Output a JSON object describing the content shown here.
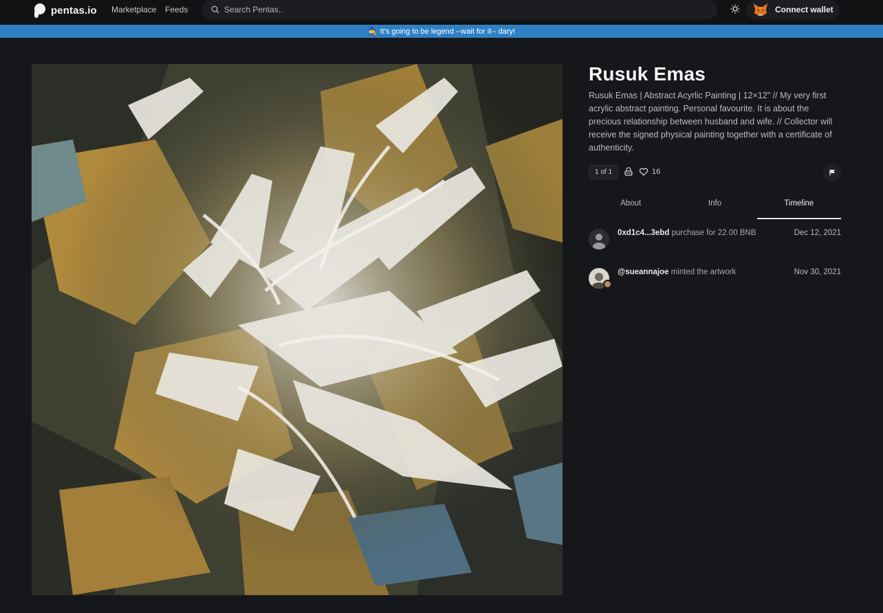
{
  "nav": {
    "logo_text": "pentas.io",
    "links": [
      "Marketplace",
      "Feeds"
    ],
    "search_placeholder": "Search Pentas..",
    "connect_label": "Connect wallet"
  },
  "banner": {
    "icon": "🧙",
    "text": "It's going to be legend --wait for it-- dary!"
  },
  "artwork": {
    "title": "Rusuk Emas",
    "description": "Rusuk Emas | Abstract Acyrlic Painting | 12×12\" // My very first acrylic abstract painting. Personal favourite. It is about the precious relationship between husband and wife. // Collector will receive the signed physical painting together with a certificate of authenticity.",
    "edition": "1 of 1",
    "likes": "16"
  },
  "tabs": [
    {
      "label": "About"
    },
    {
      "label": "Info"
    },
    {
      "label": "Timeline"
    }
  ],
  "timeline": [
    {
      "actor": "0xd1c4...3ebd",
      "action": "purchase for 22.00 BNB",
      "date": "Dec 12, 2021"
    },
    {
      "actor": "@sueannajoe",
      "action": "minted the artwork",
      "date": "Nov 30, 2021"
    }
  ],
  "colors": {
    "background": "#16171b",
    "banner": "#2f80c4",
    "topbar": "#111214"
  }
}
